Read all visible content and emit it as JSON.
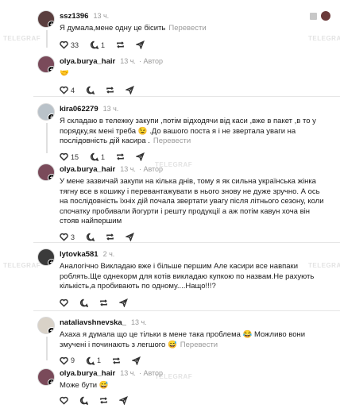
{
  "watermark": "TELEGRAF",
  "translate_label": "Перевести",
  "author_label": "Автор",
  "comments": [
    {
      "user": "ssz1396",
      "time": "13 ч.",
      "text": "Я думала,мене одну це бісить",
      "likes": "33",
      "replies": "1",
      "reposts": "",
      "avatar_color": "#5a3e3e"
    },
    {
      "user": "olya.burya_hair",
      "time": "13 ч.",
      "text": "🤝",
      "likes": "4",
      "replies": "",
      "reposts": "",
      "avatar_color": "#7a4a5a"
    },
    {
      "user": "kira062279",
      "time": "13 ч.",
      "text": "Я складаю в тележку закупи ,потім відходячи від каси ,вже в пакет ,в то у порядку,як мені треба 😉 .До вашого поста я і не звертала уваги на послідовність дій касира .",
      "likes": "15",
      "replies": "1",
      "reposts": "",
      "avatar_color": "#b9c2c9"
    },
    {
      "user": "olya.burya_hair",
      "time": "13 ч.",
      "text": "У мене зазвичай закупи на кілька днів, тому я як сильна українська жінка тягну все в кошику і перевантажувати в нього знову не дуже зручно. А ось на послідовність їхніх дій почала звертати увагу після літнього сезону, коли спочатку пробивали йогурти і решту продукції а аж потім кавун хоча він стояв найпершим",
      "likes": "3",
      "replies": "",
      "reposts": "",
      "avatar_color": "#7a4a5a"
    },
    {
      "user": "lytovka581",
      "time": "2 ч.",
      "text": "Аналогічно Викладаю вже і більше першим Але касири все навпаки роблять.Ще однекорм для котів викладаю купкою по назвам.Не рахують кількість,а пробивають по одному....Нащо!!!?",
      "likes": "",
      "replies": "",
      "reposts": "",
      "avatar_color": "#3b3b3b"
    },
    {
      "user": "nataliavshnevska_",
      "time": "13 ч.",
      "text": "Ахаха я думала що це тільки в мене така проблема 😂 Можливо вони змучені і починають з легшого 😅",
      "likes": "9",
      "replies": "1",
      "reposts": "",
      "avatar_color": "#d9d2c8"
    },
    {
      "user": "olya.burya_hair",
      "time": "13 ч.",
      "text": "Може бути 😅",
      "likes": "",
      "replies": "",
      "reposts": "",
      "avatar_color": "#7a4a5a"
    }
  ],
  "colors": {
    "text": "#1a1a1a",
    "meta": "#999999",
    "divider": "#e6e6e6"
  }
}
